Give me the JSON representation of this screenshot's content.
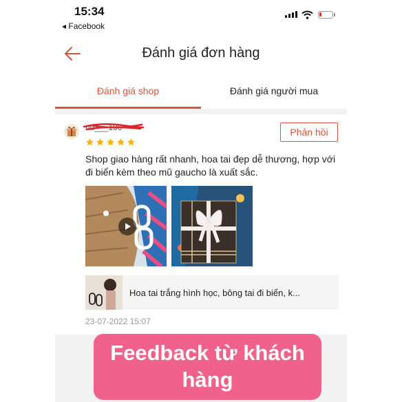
{
  "status_bar": {
    "time": "15:34",
    "back_app": "◂ Facebook",
    "icons": [
      "signal-icon",
      "wifi-icon",
      "battery-icon"
    ],
    "battery_color": "#e5322d"
  },
  "header": {
    "title": "Đánh giá đơn hàng",
    "back_icon": "back-arrow-icon",
    "accent_color": "#d9553a"
  },
  "tabs": [
    {
      "label": "Đánh giá shop",
      "active": true
    },
    {
      "label": "Đánh giá người mua",
      "active": false
    }
  ],
  "review": {
    "username": "nu___100",
    "rating": 5,
    "reply_label": "Phản hồi",
    "text": "Shop giao hàng rất nhanh, hoa tai đẹp dễ thương, hợp với đi biển kèm theo mũ gaucho là xuất sắc.",
    "media": [
      "video",
      "photo"
    ],
    "product_name": "Hoa tai trắng hình học, bông tai đi biển, k...",
    "date": "23-07-2022 15:07"
  },
  "overlay": {
    "text": "Feedback từ khách hàng",
    "color": "#f0628c"
  }
}
